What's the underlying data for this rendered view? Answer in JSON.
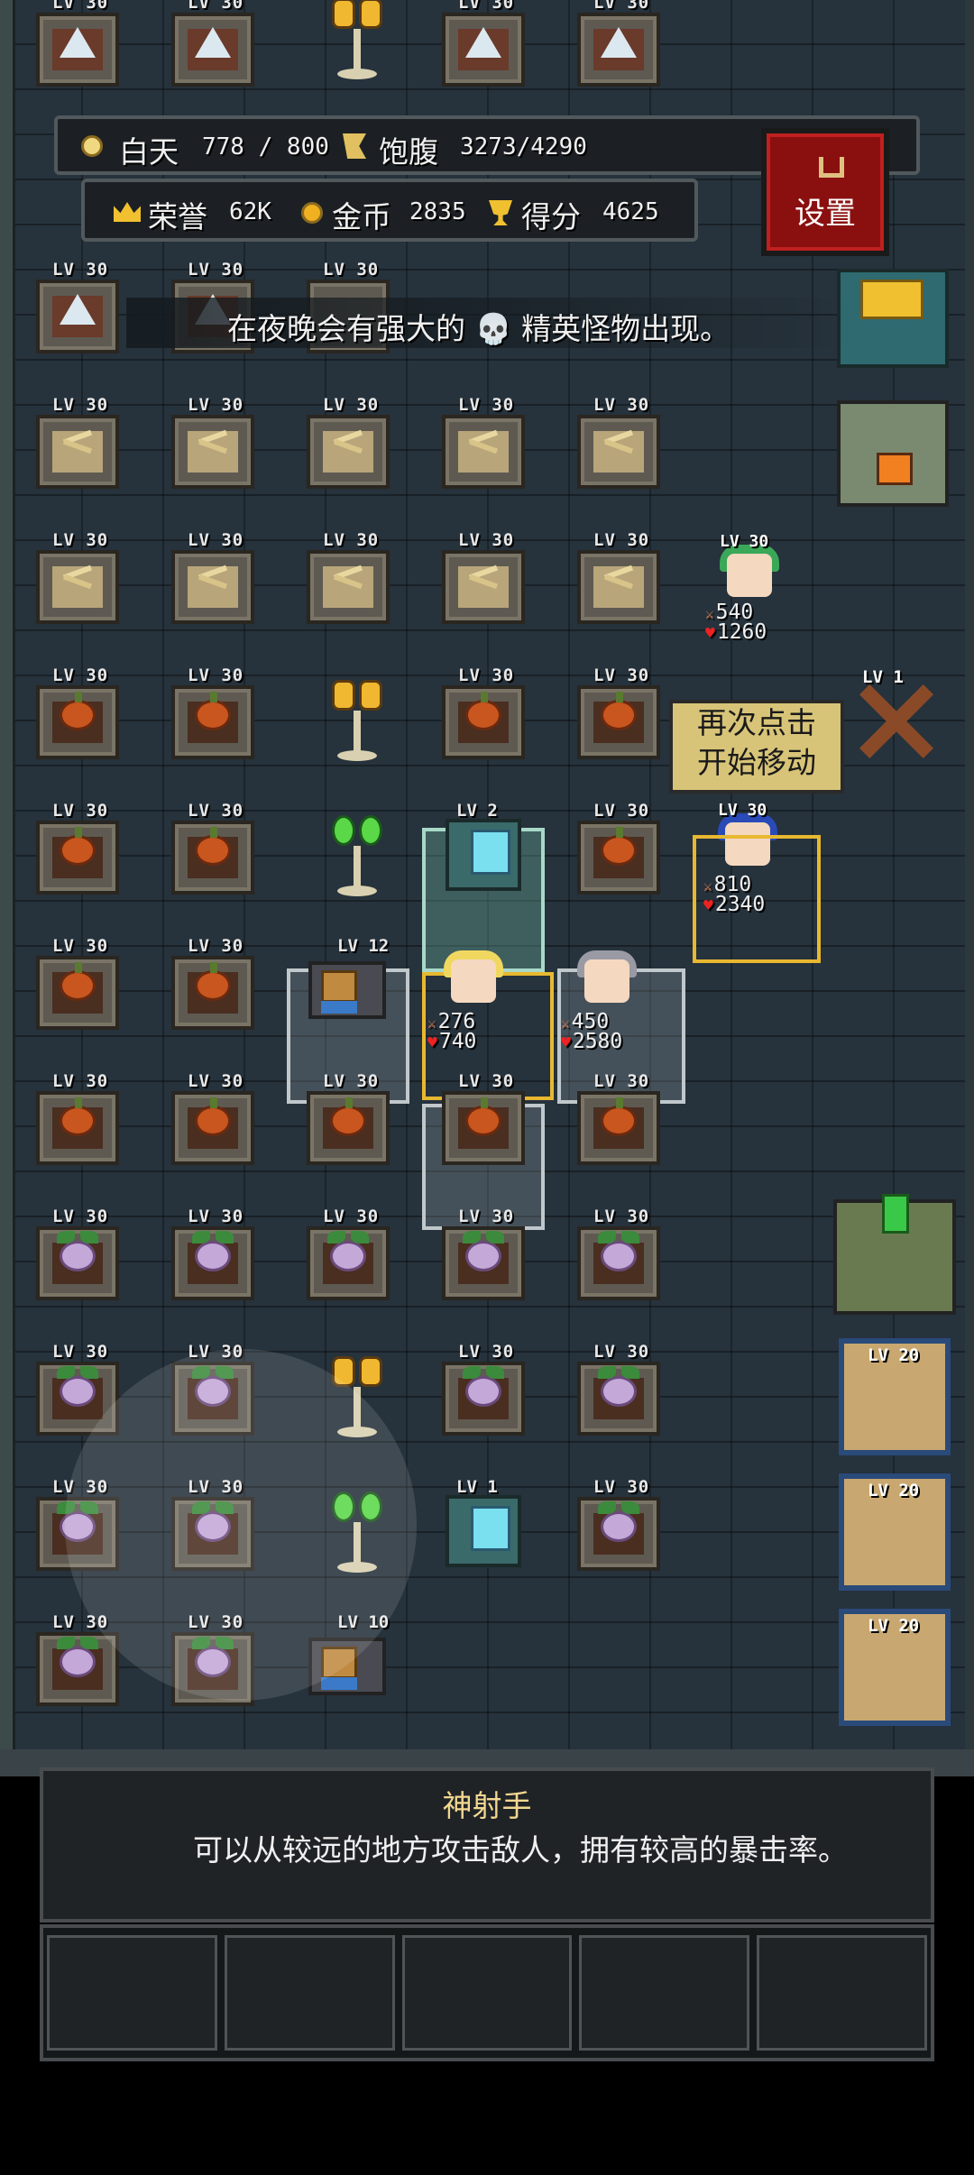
{
  "hud": {
    "day_label": "白天",
    "day_progress": "778 / 800",
    "satiety_label": "饱腹",
    "satiety_value": "3273/4290",
    "honor_label": "荣誉",
    "honor_value": "62K",
    "gold_label": "金币",
    "gold_value": "2835",
    "score_label": "得分",
    "score_value": "4625"
  },
  "settings_button": {
    "label": "设置"
  },
  "notice": {
    "text": "在夜晚会有强大的 💀 精英怪物出现。"
  },
  "tile_level": "LV 30",
  "machine_levels": {
    "top": "LV 2",
    "bottom": "LV 1"
  },
  "loom_levels": {
    "middle": "LV 12",
    "bottom": "LV 10"
  },
  "units": {
    "archer_green": {
      "level": "LV 30",
      "atk": "540",
      "hp": "1260"
    },
    "archer_blue": {
      "level": "LV 30",
      "atk": "810",
      "hp": "2340"
    },
    "mage_blonde": {
      "atk": "276",
      "hp": "740"
    },
    "knight_gray": {
      "atk": "450",
      "hp": "2580"
    }
  },
  "tooltip": {
    "line1": "再次点击",
    "line2": "开始移动"
  },
  "right_buildings": {
    "crossed_logs_level": "LV 1",
    "tower_levels": [
      "LV 20",
      "LV 20",
      "LV 20"
    ]
  },
  "info_panel": {
    "title": "神射手",
    "description": "可以从较远的地方攻击敌人，拥有较高的暴击率。"
  },
  "colors": {
    "background": "#26323c",
    "settings_red": "#8a1010",
    "title_gold": "#f2d890",
    "tooltip_bg": "#d8c478"
  }
}
